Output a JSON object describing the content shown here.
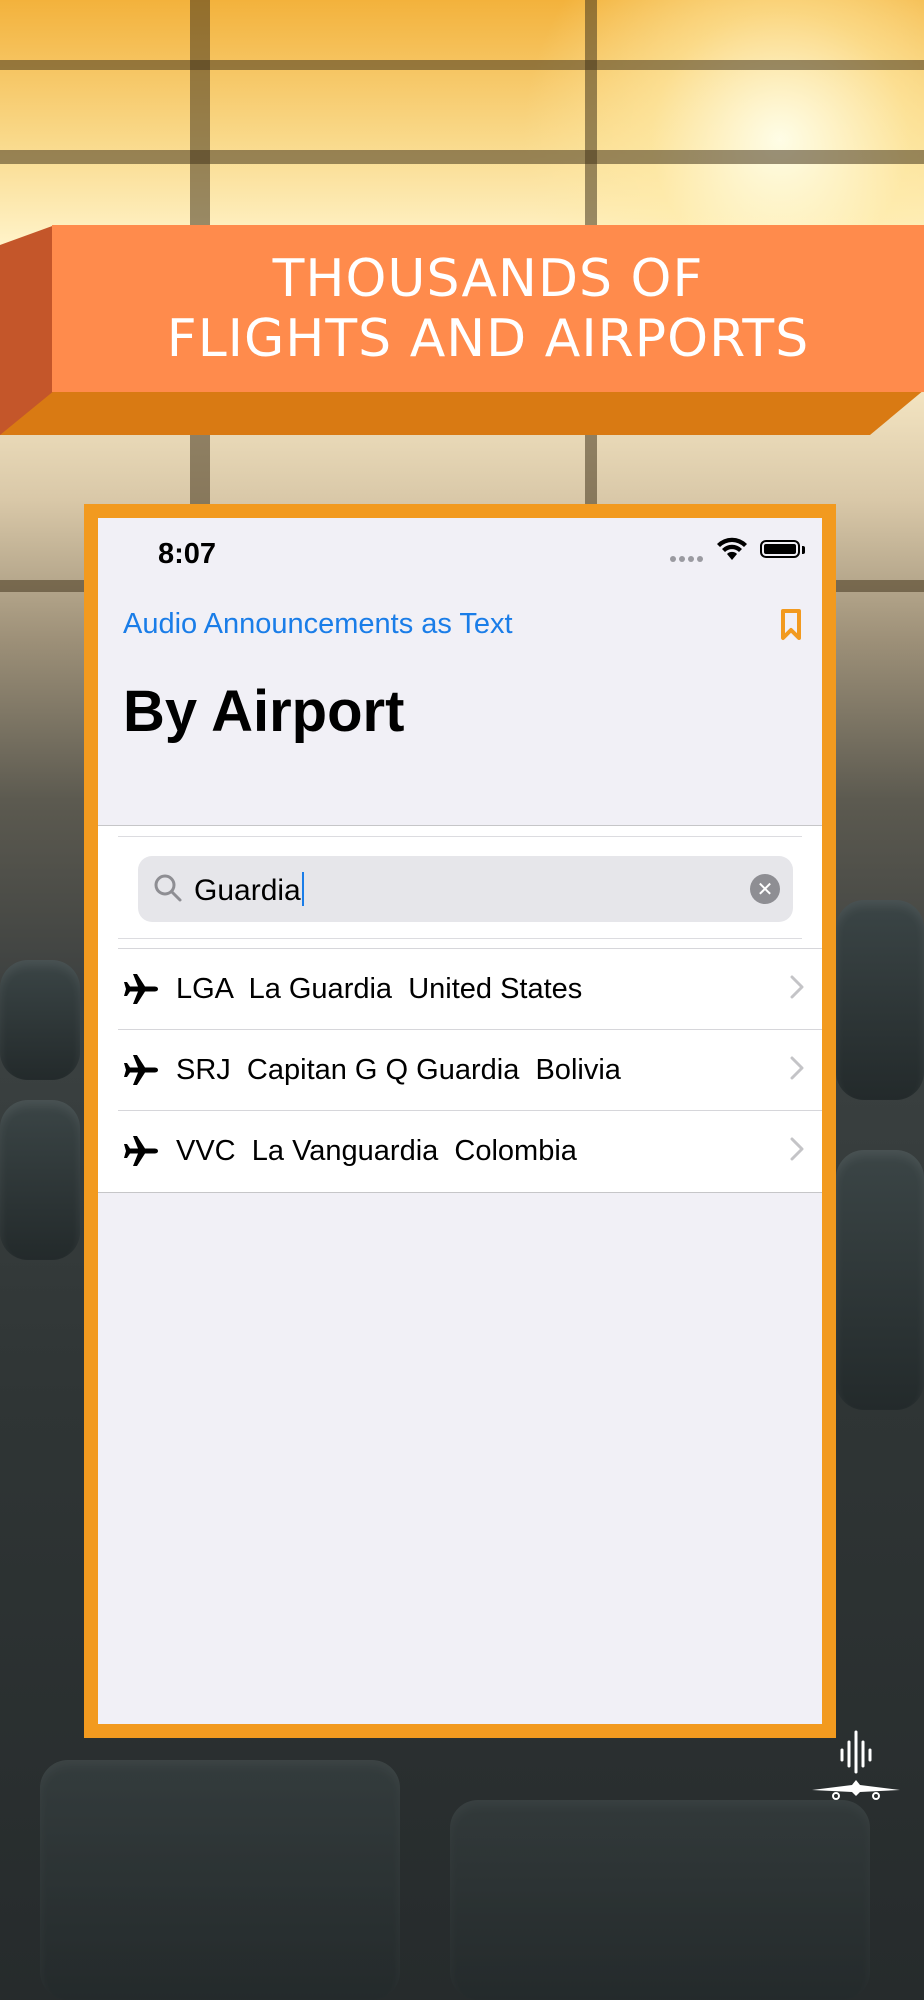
{
  "banner": {
    "line1": "THOUSANDS OF",
    "line2": "FLIGHTS AND AIRPORTS"
  },
  "status_bar": {
    "time": "8:07"
  },
  "nav": {
    "back_label": "Audio Announcements as Text",
    "bookmark_icon": "bookmark-icon"
  },
  "page": {
    "title": "By Airport"
  },
  "search": {
    "value": "Guardia",
    "icon": "search-icon",
    "clear_icon": "clear-icon"
  },
  "results": [
    {
      "code": "LGA",
      "name": "La Guardia",
      "country": "United States"
    },
    {
      "code": "SRJ",
      "name": "Capitan G Q Guardia",
      "country": "Bolivia"
    },
    {
      "code": "VVC",
      "name": "La Vanguardia",
      "country": "Colombia"
    }
  ],
  "colors": {
    "accent": "#1a7de8",
    "frame": "#f29a1f",
    "banner": "#ff8b4c",
    "bookmark": "#f29a1f"
  }
}
